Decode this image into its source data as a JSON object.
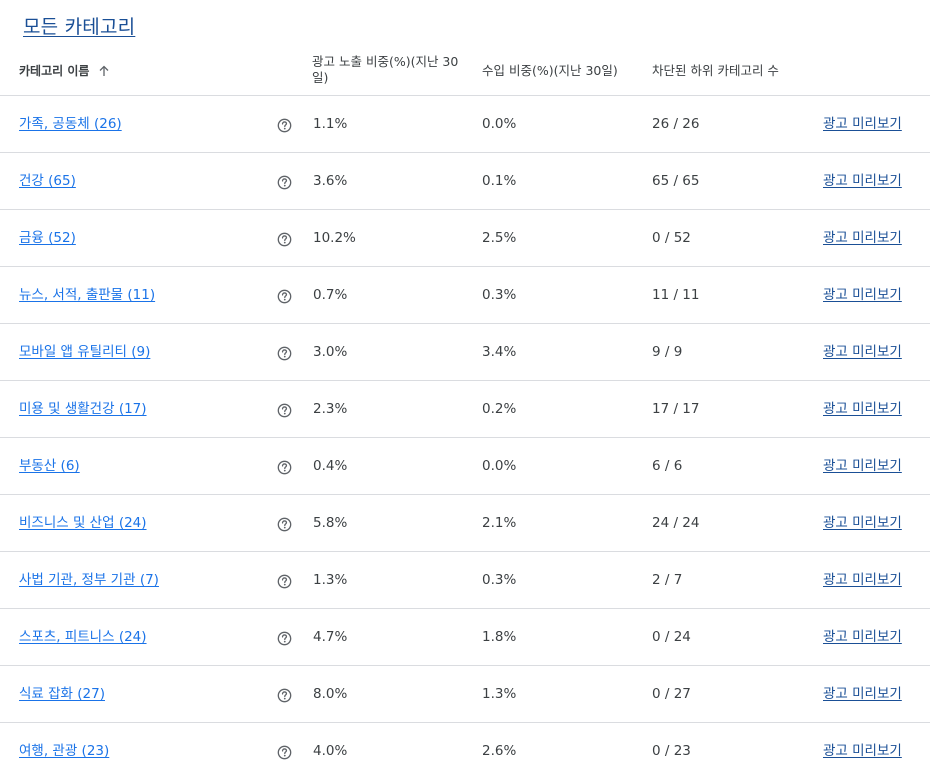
{
  "breadcrumb": {
    "label": "모든 카테고리"
  },
  "table": {
    "headers": {
      "name": "카테고리 이름",
      "impressions": "광고 노출 비중(%)(지난 30일)",
      "revenue": "수입 비중(%)(지난 30일)",
      "blocked": "차단된 하위 카테고리 수"
    },
    "sort_icon": "arrow-up-icon",
    "help_icon": "help-circle-icon",
    "rows": [
      {
        "name": "가족, 공동체 (26)",
        "impressions": "1.1%",
        "revenue": "0.0%",
        "blocked": "26 / 26",
        "preview": "광고 미리보기"
      },
      {
        "name": "건강 (65)",
        "impressions": "3.6%",
        "revenue": "0.1%",
        "blocked": "65 / 65",
        "preview": "광고 미리보기"
      },
      {
        "name": "금융 (52)",
        "impressions": "10.2%",
        "revenue": "2.5%",
        "blocked": "0 / 52",
        "preview": "광고 미리보기"
      },
      {
        "name": "뉴스, 서적, 출판물 (11)",
        "impressions": "0.7%",
        "revenue": "0.3%",
        "blocked": "11 / 11",
        "preview": "광고 미리보기"
      },
      {
        "name": "모바일 앱 유틸리티 (9)",
        "impressions": "3.0%",
        "revenue": "3.4%",
        "blocked": "9 / 9",
        "preview": "광고 미리보기"
      },
      {
        "name": "미용 및 생활건강 (17)",
        "impressions": "2.3%",
        "revenue": "0.2%",
        "blocked": "17 / 17",
        "preview": "광고 미리보기"
      },
      {
        "name": "부동산 (6)",
        "impressions": "0.4%",
        "revenue": "0.0%",
        "blocked": "6 / 6",
        "preview": "광고 미리보기"
      },
      {
        "name": "비즈니스 및 산업 (24)",
        "impressions": "5.8%",
        "revenue": "2.1%",
        "blocked": "24 / 24",
        "preview": "광고 미리보기"
      },
      {
        "name": "사법 기관, 정부 기관 (7)",
        "impressions": "1.3%",
        "revenue": "0.3%",
        "blocked": "2 / 7",
        "preview": "광고 미리보기"
      },
      {
        "name": "스포츠, 피트니스 (24)",
        "impressions": "4.7%",
        "revenue": "1.8%",
        "blocked": "0 / 24",
        "preview": "광고 미리보기"
      },
      {
        "name": "식료 잡화 (27)",
        "impressions": "8.0%",
        "revenue": "1.3%",
        "blocked": "0 / 27",
        "preview": "광고 미리보기"
      },
      {
        "name": "여행, 관광 (23)",
        "impressions": "4.0%",
        "revenue": "2.6%",
        "blocked": "0 / 23",
        "preview": "광고 미리보기"
      }
    ]
  }
}
